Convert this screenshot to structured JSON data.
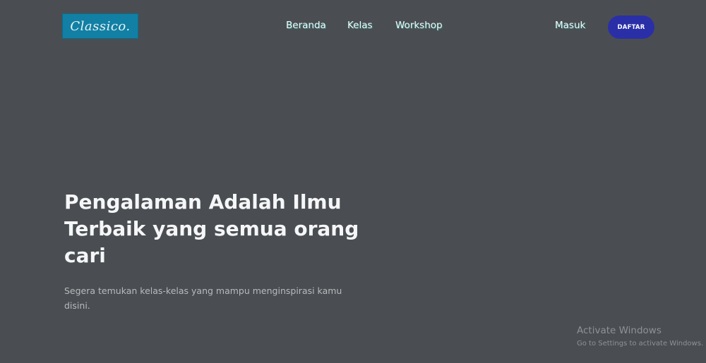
{
  "header": {
    "logo_text": "Classico.",
    "nav": {
      "beranda": "Beranda",
      "kelas": "Kelas",
      "workshop": "Workshop"
    },
    "login_label": "Masuk",
    "signup_label": "DAFTAR"
  },
  "hero": {
    "title": "Pengalaman Adalah Ilmu Terbaik yang semua orang cari",
    "subtitle": "Segera temukan kelas-kelas yang mampu menginspirasi kamu disini."
  },
  "watermark": {
    "title": "Activate Windows",
    "subtitle": "Go to Settings to activate Windows."
  },
  "colors": {
    "background": "#4a4e52",
    "logo_bg": "#1180a4",
    "button_bg": "#2a2fa8"
  }
}
